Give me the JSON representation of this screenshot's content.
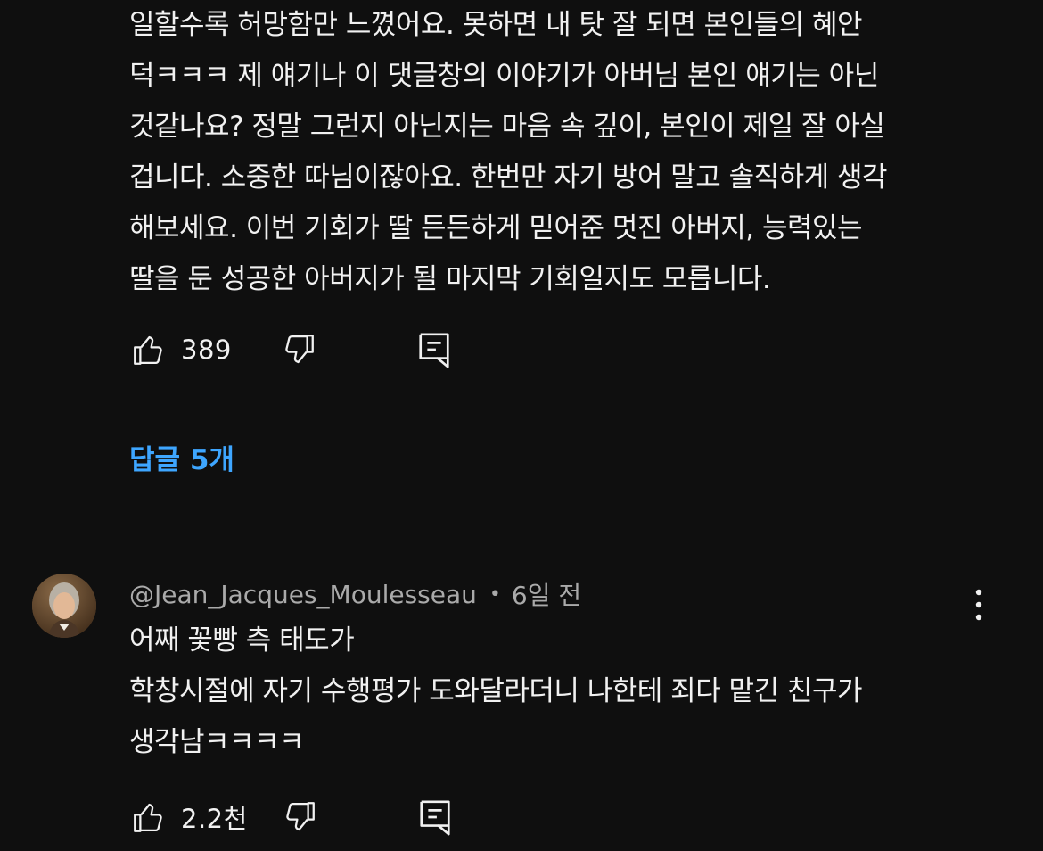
{
  "comment1": {
    "text": "일할수록 허망함만 느꼈어요. 못하면 내 탓 잘 되면 본인들의 혜안\n덕ㅋㅋㅋ 제 얘기나 이 댓글창의 이야기가 아버님 본인 얘기는 아닌\n것같나요? 정말 그런지 아닌지는 마음 속 깊이, 본인이 제일 잘 아실\n겁니다. 소중한 따님이잖아요. 한번만 자기 방어 말고 솔직하게 생각\n해보세요. 이번 기회가 딸 든든하게 믿어준 멋진 아버지, 능력있는\n딸을 둔 성공한 아버지가 될 마지막 기회일지도 모릅니다.",
    "like_count": "389",
    "replies_label": "답글 5개"
  },
  "comment2": {
    "author": "@Jean_Jacques_Moulesseau",
    "separator": "•",
    "time": "6일 전",
    "text": "어째 꽃빵 측 태도가\n학창시절에 자기 수행평가 도와달라더니 나한테 죄다 맡긴 친구가\n생각남ㅋㅋㅋㅋ",
    "like_count": "2.2천"
  },
  "icons": {
    "like": "thumbs-up-icon",
    "dislike": "thumbs-down-icon",
    "reply": "reply-comment-icon",
    "menu": "more-vertical-icon"
  },
  "colors": {
    "background": "#0f0f0f",
    "text": "#f1f1f1",
    "secondary_text": "#aaaaaa",
    "link": "#3ea6ff"
  }
}
